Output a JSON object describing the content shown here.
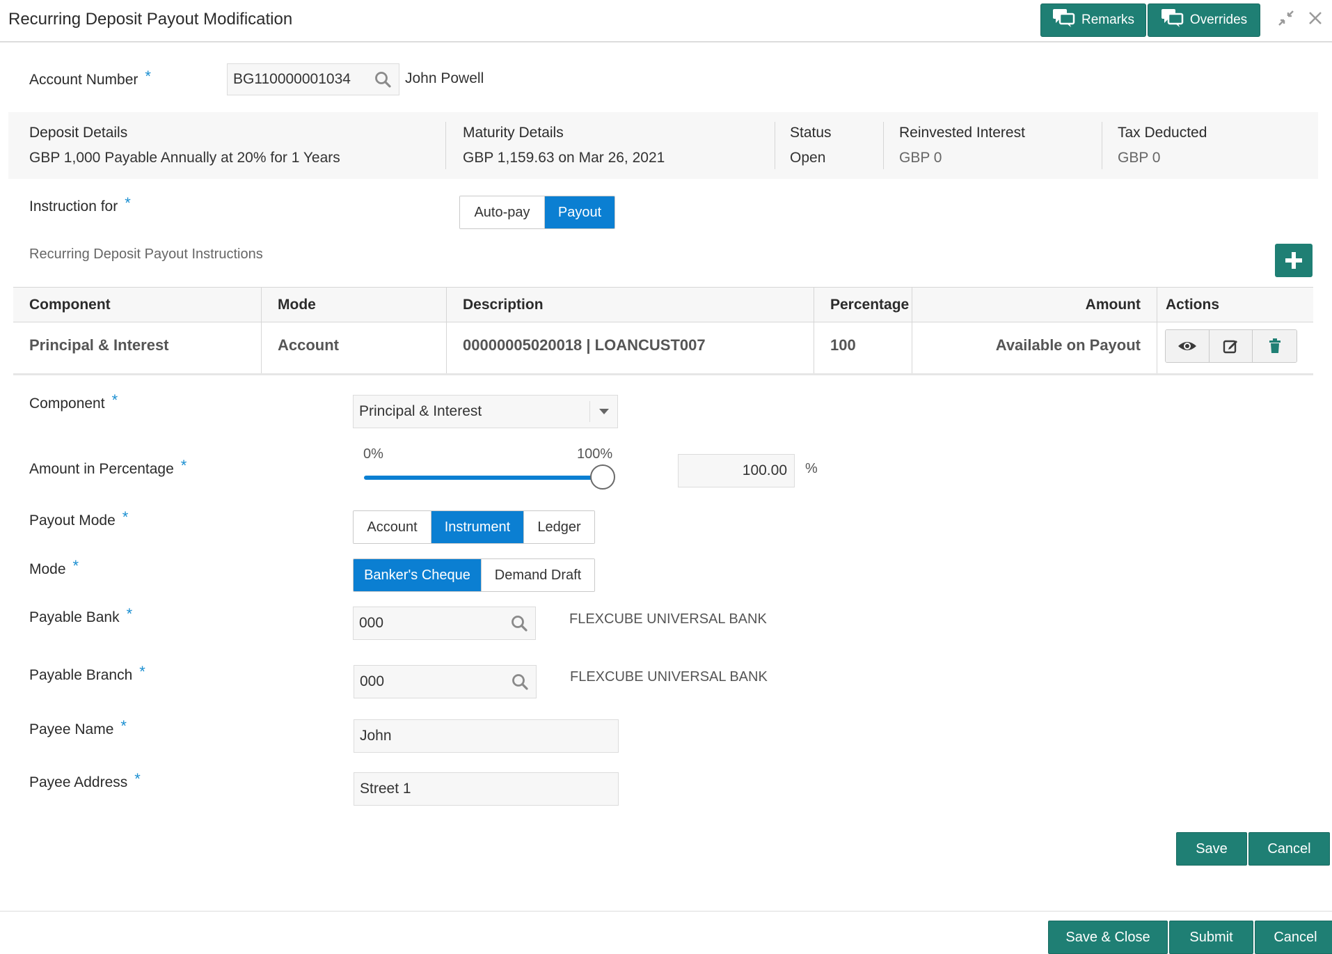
{
  "header": {
    "title": "Recurring Deposit Payout Modification",
    "remarks_label": "Remarks",
    "overrides_label": "Overrides"
  },
  "account": {
    "label": "Account Number",
    "value": "BG110000001034",
    "name": "John Powell"
  },
  "summary": {
    "deposit_details_label": "Deposit Details",
    "deposit_details_value": "GBP 1,000 Payable Annually at 20% for 1 Years",
    "maturity_details_label": "Maturity Details",
    "maturity_details_value": "GBP 1,159.63 on Mar 26, 2021",
    "status_label": "Status",
    "status_value": "Open",
    "reinvested_interest_label": "Reinvested Interest",
    "reinvested_interest_value": "GBP 0",
    "tax_deducted_label": "Tax Deducted",
    "tax_deducted_value": "GBP 0"
  },
  "instruction": {
    "label": "Instruction for",
    "options": [
      "Auto-pay",
      "Payout"
    ],
    "selected": "Payout"
  },
  "instructions_section": {
    "title": "Recurring Deposit Payout Instructions"
  },
  "table": {
    "columns": [
      "Component",
      "Mode",
      "Description",
      "Percentage",
      "Amount",
      "Actions"
    ],
    "rows": [
      {
        "component": "Principal & Interest",
        "mode": "Account",
        "description": "00000005020018 | LOANCUST007",
        "percentage": "100",
        "amount": "Available on Payout"
      }
    ]
  },
  "form": {
    "component_label": "Component",
    "component_value": "Principal & Interest",
    "amount_pct_label": "Amount in Percentage",
    "slider_min_label": "0%",
    "slider_max_label": "100%",
    "slider_value": 100,
    "amount_pct_value": "100.00",
    "pct_symbol": "%",
    "payout_mode_label": "Payout Mode",
    "payout_mode_options": [
      "Account",
      "Instrument",
      "Ledger"
    ],
    "payout_mode_selected": "Instrument",
    "mode_label": "Mode",
    "mode_options": [
      "Banker's Cheque",
      "Demand Draft"
    ],
    "mode_selected": "Banker's Cheque",
    "payable_bank_label": "Payable Bank",
    "payable_bank_value": "000",
    "payable_bank_name": "FLEXCUBE UNIVERSAL BANK",
    "payable_branch_label": "Payable Branch",
    "payable_branch_value": "000",
    "payable_branch_name": "FLEXCUBE UNIVERSAL BANK",
    "payee_name_label": "Payee Name",
    "payee_name_value": "John",
    "payee_address_label": "Payee Address",
    "payee_address_value": "Street 1",
    "save_label": "Save",
    "cancel_label": "Cancel"
  },
  "footer": {
    "save_close_label": "Save & Close",
    "submit_label": "Submit",
    "cancel_label": "Cancel"
  },
  "icons": {
    "remarks": "chat-bubbles-icon",
    "overrides": "chat-bubbles-icon",
    "minimize": "collapse-arrows-icon",
    "close": "close-icon",
    "search": "search-icon",
    "add": "plus-icon",
    "view": "eye-icon",
    "edit": "edit-icon",
    "delete": "trash-icon",
    "dropdown": "caret-down-icon"
  },
  "colors": {
    "primary_button": "#1f7f74",
    "selected_toggle": "#0b7fd2",
    "required_star": "#1b8fd1",
    "summary_bg": "#f7f7f7"
  }
}
